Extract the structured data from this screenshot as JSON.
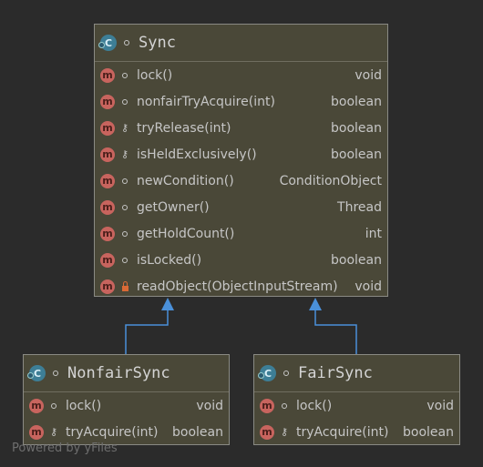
{
  "diagram": {
    "watermark": "Powered by yFiles",
    "sync": {
      "title": "Sync",
      "members": [
        {
          "name": "lock()",
          "type": "void",
          "visibility": "package"
        },
        {
          "name": "nonfairTryAcquire(int)",
          "type": "boolean",
          "visibility": "package"
        },
        {
          "name": "tryRelease(int)",
          "type": "boolean",
          "visibility": "protected"
        },
        {
          "name": "isHeldExclusively()",
          "type": "boolean",
          "visibility": "protected"
        },
        {
          "name": "newCondition()",
          "type": "ConditionObject",
          "visibility": "package"
        },
        {
          "name": "getOwner()",
          "type": "Thread",
          "visibility": "package"
        },
        {
          "name": "getHoldCount()",
          "type": "int",
          "visibility": "package"
        },
        {
          "name": "isLocked()",
          "type": "boolean",
          "visibility": "package"
        },
        {
          "name": "readObject(ObjectInputStream)",
          "type": "void",
          "visibility": "private"
        }
      ]
    },
    "nonfair_sync": {
      "title": "NonfairSync",
      "members": [
        {
          "name": "lock()",
          "type": "void",
          "visibility": "package"
        },
        {
          "name": "tryAcquire(int)",
          "type": "boolean",
          "visibility": "protected"
        }
      ]
    },
    "fair_sync": {
      "title": "FairSync",
      "members": [
        {
          "name": "lock()",
          "type": "void",
          "visibility": "package"
        },
        {
          "name": "tryAcquire(int)",
          "type": "boolean",
          "visibility": "protected"
        }
      ]
    },
    "icons": {
      "class": "C",
      "method": "m"
    },
    "colors": {
      "background": "#2b2b2b",
      "class_fill": "#4a4838",
      "class_icon": "#3d7e96",
      "method_icon": "#c8645e",
      "edge": "#4a90d9"
    }
  }
}
